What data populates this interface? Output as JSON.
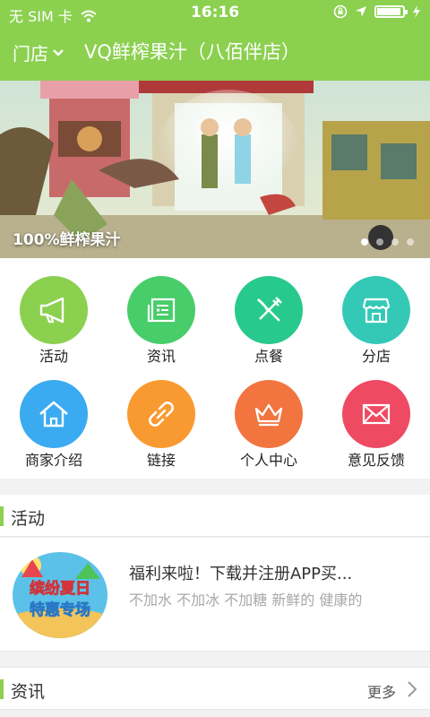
{
  "status_bar": {
    "carrier": "无 SIM 卡",
    "time": "16:16"
  },
  "nav": {
    "store_label": "门店",
    "title": "VQ鲜榨果汁（八佰伴店）"
  },
  "banner": {
    "caption": "100%鲜榨果汁",
    "active_dot": 1,
    "dot_count": 4
  },
  "menu": [
    {
      "label": "活动",
      "icon": "megaphone-icon",
      "color": "#8bd04f"
    },
    {
      "label": "资讯",
      "icon": "news-icon",
      "color": "#47cd6a"
    },
    {
      "label": "点餐",
      "icon": "utensils-icon",
      "color": "#28c98c"
    },
    {
      "label": "分店",
      "icon": "store-icon",
      "color": "#34c9b7"
    },
    {
      "label": "商家介绍",
      "icon": "home-icon",
      "color": "#3aabf0"
    },
    {
      "label": "链接",
      "icon": "link-icon",
      "color": "#f99a31"
    },
    {
      "label": "个人中心",
      "icon": "crown-icon",
      "color": "#f2743e"
    },
    {
      "label": "意见反馈",
      "icon": "mail-icon",
      "color": "#ee4a62"
    }
  ],
  "activity_section": {
    "title": "活动",
    "item": {
      "title": "福利来啦！下载并注册APP买...",
      "desc": "不加水 不加冰 不加糖 新鲜的 健康的",
      "thumb_text_1": "缤纷夏日",
      "thumb_text_2": "特惠专场"
    }
  },
  "news_section": {
    "title": "资讯",
    "more": "更多"
  },
  "colors": {
    "accent": "#8bd04f"
  }
}
